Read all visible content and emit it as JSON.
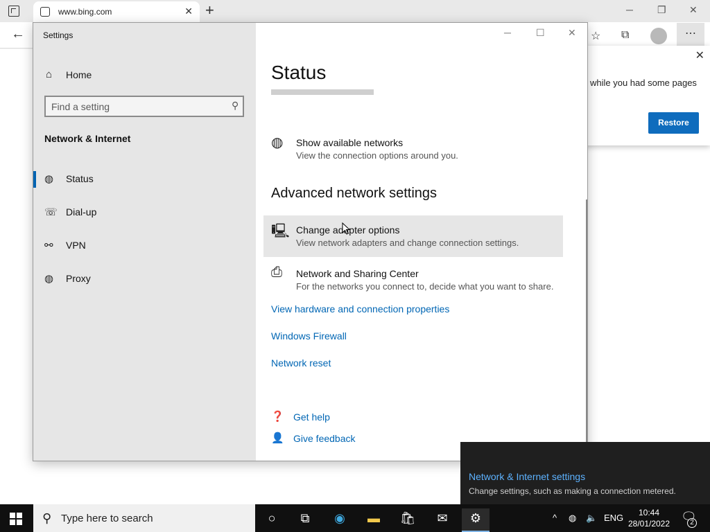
{
  "browser": {
    "tab_title": "www.bing.com",
    "tab_close": "✕",
    "new_tab": "+",
    "window_controls": {
      "minimize": "─",
      "restore": "❐",
      "close": "✕"
    },
    "back": "←",
    "toolbar_icons": {
      "favorites": "☆",
      "collections": "⧉",
      "more": "⋯"
    }
  },
  "restore_popup": {
    "message": "while you had some pages",
    "button": "Restore",
    "close": "✕"
  },
  "settings": {
    "app_title": "Settings",
    "window_controls": {
      "minimize": "─",
      "maximize": "☐",
      "close": "✕"
    },
    "home_label": "Home",
    "search_placeholder": "Find a setting",
    "section_heading": "Network & Internet",
    "nav": [
      {
        "label": "Status",
        "icon": "globe-icon",
        "glyph": "◍",
        "active": true
      },
      {
        "label": "Dial-up",
        "icon": "dialup-icon",
        "glyph": "☏",
        "active": false
      },
      {
        "label": "VPN",
        "icon": "vpn-icon",
        "glyph": "⚯",
        "active": false
      },
      {
        "label": "Proxy",
        "icon": "globe-icon",
        "glyph": "◍",
        "active": false
      }
    ],
    "main": {
      "title": "Status",
      "show_networks": {
        "title": "Show available networks",
        "desc": "View the connection options around you."
      },
      "advanced_heading": "Advanced network settings",
      "change_adapter": {
        "title": "Change adapter options",
        "desc": "View network adapters and change connection settings."
      },
      "sharing_center": {
        "title": "Network and Sharing Center",
        "desc": "For the networks you connect to, decide what you want to share."
      },
      "links": {
        "hardware": "View hardware and connection properties",
        "firewall": "Windows Firewall",
        "reset": "Network reset"
      },
      "help": {
        "get_help": "Get help",
        "feedback": "Give feedback"
      }
    }
  },
  "toast": {
    "title": "Network & Internet settings",
    "body": "Change settings, such as making a connection metered."
  },
  "taskbar": {
    "search_placeholder": "Type here to search",
    "language": "ENG",
    "time": "10:44",
    "date": "28/01/2022",
    "notification_count": "2"
  }
}
